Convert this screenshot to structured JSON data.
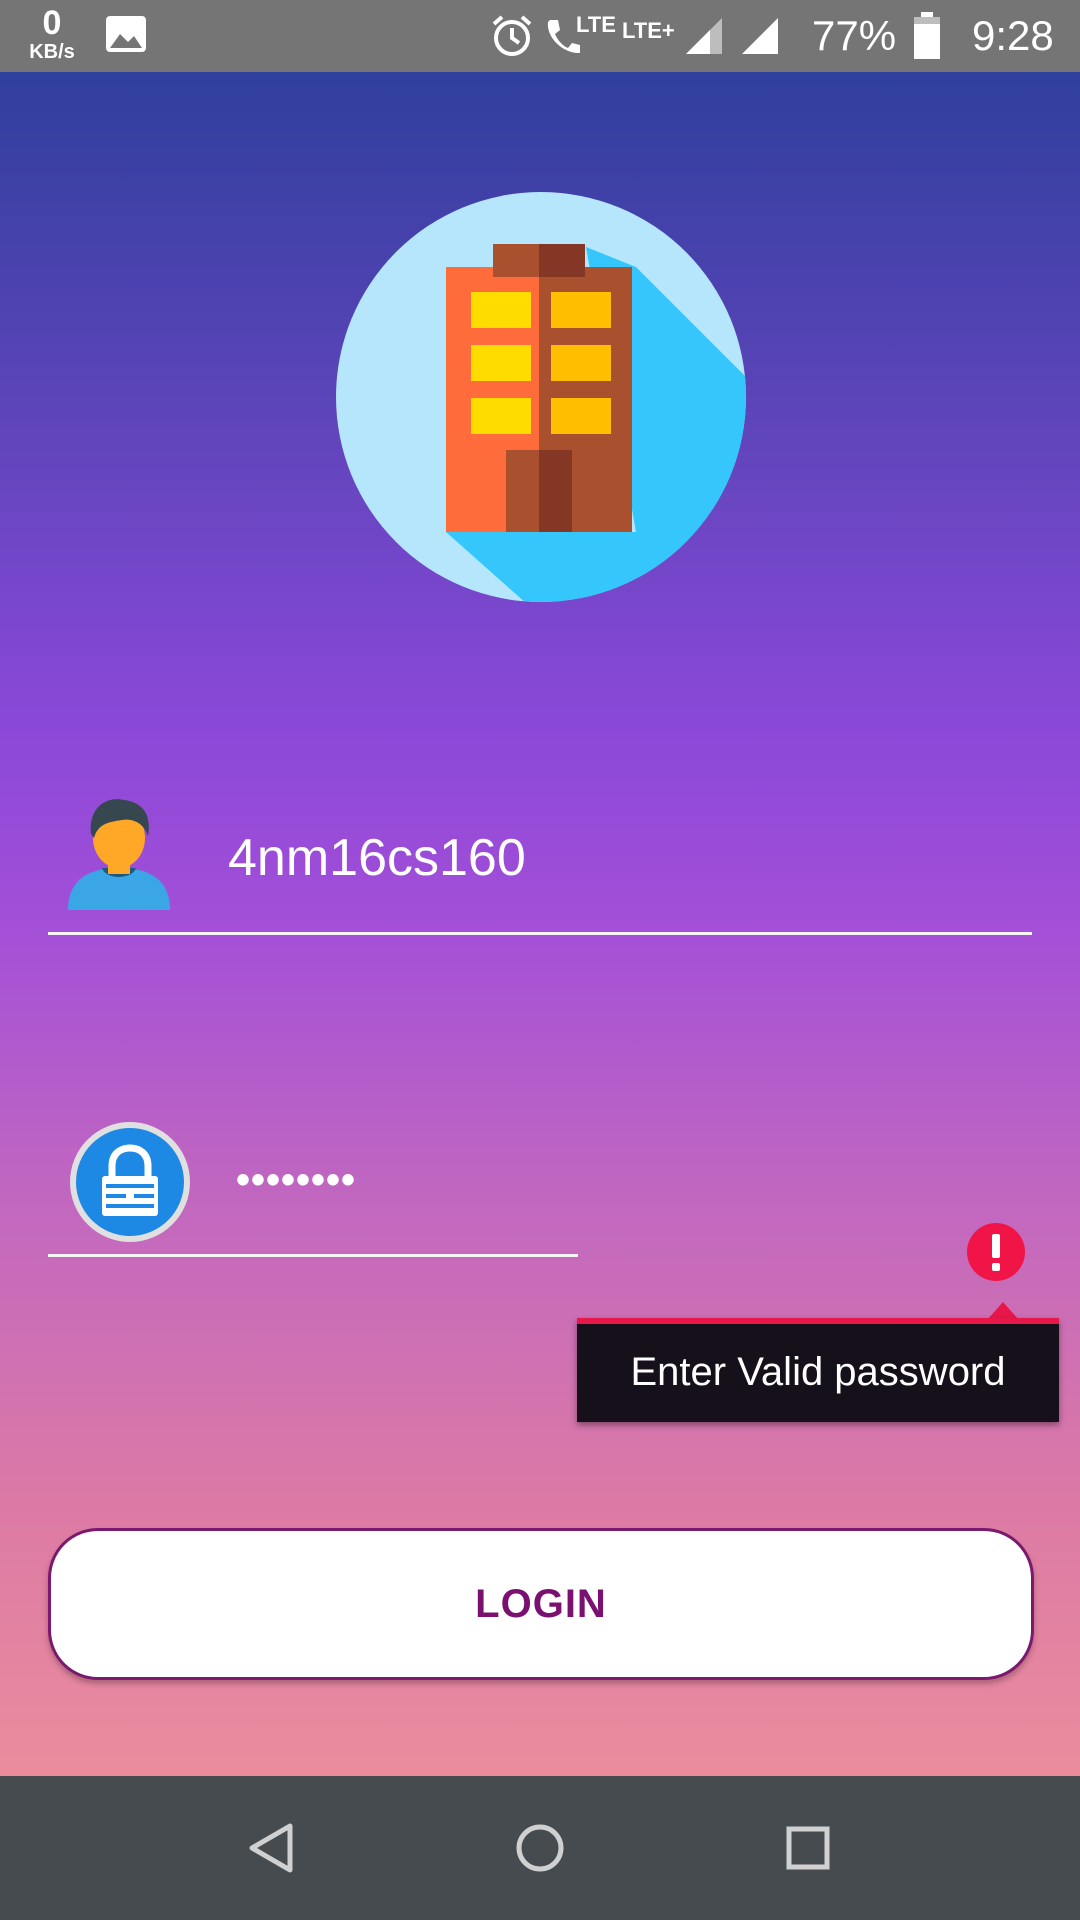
{
  "status_bar": {
    "speed_value": "0",
    "speed_unit": "KB/s",
    "network_1": "LTE",
    "network_2": "LTE+",
    "battery": "77%",
    "time": "9:28"
  },
  "login": {
    "username_value": "4nm16cs160",
    "password_value": "••••••••",
    "error_message": "Enter Valid password",
    "button_label": "LOGIN"
  },
  "colors": {
    "accent": "#7a1070",
    "error": "#e8174a"
  },
  "icons": [
    "image-icon",
    "alarm-icon",
    "call-icon",
    "signal-icon",
    "battery-icon",
    "building-logo",
    "user-avatar-icon",
    "lock-icon",
    "error-icon",
    "back-icon",
    "home-icon",
    "recents-icon"
  ]
}
